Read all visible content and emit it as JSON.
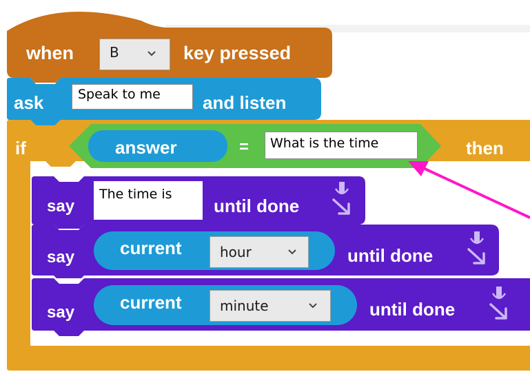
{
  "blocks": {
    "hat": {
      "when": "when",
      "key": "B",
      "key_pressed": "key pressed"
    },
    "ask": {
      "ask": "ask",
      "prompt": "Speak to me",
      "and_listen": "and listen"
    },
    "if": {
      "if": "if",
      "then": "then",
      "condition": {
        "answer": "answer",
        "op": "=",
        "value": "What is the time"
      }
    },
    "say1": {
      "say": "say",
      "text": "The time is",
      "until_done": "until done"
    },
    "say2": {
      "say": "say",
      "current": "current",
      "unit": "hour",
      "until_done": "until done"
    },
    "say3": {
      "say": "say",
      "current": "current",
      "unit": "minute",
      "until_done": "until done"
    }
  },
  "colors": {
    "events": "#c9711b",
    "events_bright": "#d17c26",
    "sensing": "#1e9bd7",
    "control": "#e6a222",
    "operators": "#5cc24a",
    "looks": "#5b1cc9",
    "arrow": "#ff17c8"
  },
  "icons": {
    "speech": "microphone-down-arrow-icon",
    "dropdown": "chevron-down-icon"
  }
}
